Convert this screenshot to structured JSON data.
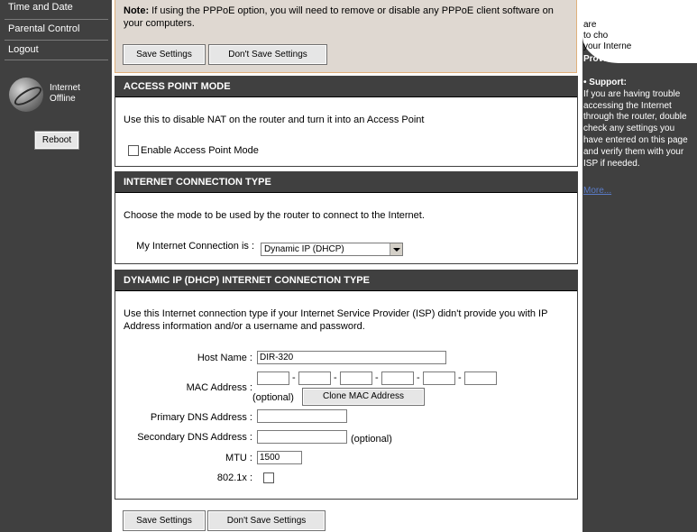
{
  "sidebar": {
    "items": [
      {
        "label": "Time and Date"
      },
      {
        "label": "Parental Control"
      },
      {
        "label": "Logout"
      }
    ],
    "status_line1": "Internet",
    "status_line2": "Offline",
    "reboot_label": "Reboot"
  },
  "note": {
    "prefix": "Note:",
    "text": " If using the PPPoE option, you will need to remove or disable any PPPoE client software on your computers.",
    "save_label": "Save Settings",
    "dont_save_label": "Don't Save Settings"
  },
  "access_point": {
    "header": "ACCESS POINT MODE",
    "description": "Use this to disable NAT on the router and turn it into an Access Point",
    "checkbox_label": "Enable Access Point Mode"
  },
  "connection_type": {
    "header": "INTERNET CONNECTION TYPE",
    "description": "Choose the mode to be used by the router to connect to the Internet.",
    "label": "My Internet Connection is :",
    "selected": "Dynamic IP (DHCP)"
  },
  "dhcp": {
    "header": "DYNAMIC IP (DHCP) INTERNET CONNECTION TYPE",
    "description": "Use this Internet connection type if your Internet Service Provider (ISP) didn't provide you with IP Address information and/or a username and password.",
    "host_name_label": "Host Name :",
    "host_name_value": "DIR-320",
    "mac_label": "MAC Address :",
    "mac_values": [
      "",
      "",
      "",
      "",
      "",
      ""
    ],
    "mac_optional": "(optional)",
    "clone_mac_label": "Clone MAC Address",
    "primary_dns_label": "Primary DNS Address :",
    "primary_dns_value": "",
    "secondary_dns_label": "Secondary DNS Address :",
    "secondary_dns_value": "",
    "secondary_optional": "(optional)",
    "mtu_label": "MTU :",
    "mtu_value": "1500",
    "dot1x_label": "802.1x :"
  },
  "bottom_buttons": {
    "save_label": "Save Settings",
    "dont_save_label": "Don't Save Settings"
  },
  "help": {
    "cloud_lines": [
      "are",
      "to cho",
      "your Interne",
      "Provider (ISP)."
    ],
    "support_title": "Support:",
    "support_text": "If you are having trouble accessing the Internet through the router, double check any settings you have entered on this page and verify them with your ISP if needed.",
    "more_label": "More..."
  }
}
